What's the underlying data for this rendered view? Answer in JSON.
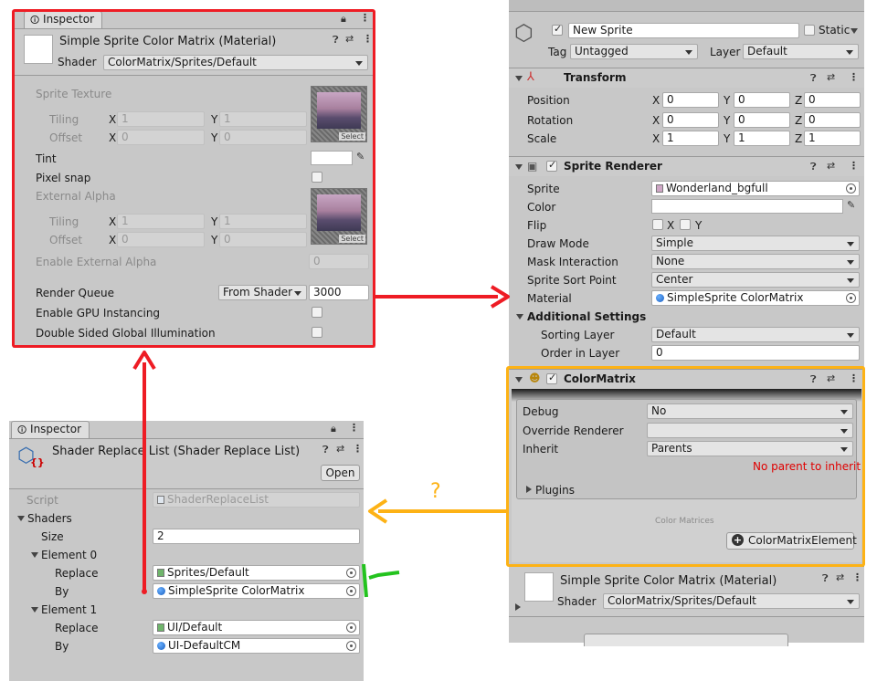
{
  "material_inspector": {
    "tab": "Inspector",
    "title": "Simple Sprite Color Matrix (Material)",
    "shader_label": "Shader",
    "shader_value": "ColorMatrix/Sprites/Default",
    "sprite_texture": "Sprite Texture",
    "tiling": "Tiling",
    "offset": "Offset",
    "x": "X",
    "y": "Y",
    "tiling_x": "1",
    "tiling_y": "1",
    "offset_x": "0",
    "offset_y": "0",
    "select": "Select",
    "tint": "Tint",
    "pixel_snap": "Pixel snap",
    "external_alpha": "External Alpha",
    "tiling2_x": "1",
    "tiling2_y": "1",
    "offset2_x": "0",
    "offset2_y": "0",
    "enable_external_alpha": "Enable External Alpha",
    "enable_external_alpha_value": "0",
    "render_queue": "Render Queue",
    "render_queue_mode": "From Shader",
    "render_queue_value": "3000",
    "gpu_instancing": "Enable GPU Instancing",
    "double_sided": "Double Sided Global Illumination"
  },
  "shader_replace": {
    "tab": "Inspector",
    "title": "Shader Replace List (Shader Replace List)",
    "open": "Open",
    "script_label": "Script",
    "script_value": "ShaderReplaceList",
    "shaders": "Shaders",
    "size_label": "Size",
    "size_value": "2",
    "element0": "Element 0",
    "replace": "Replace",
    "by": "By",
    "e0_replace": "Sprites/Default",
    "e0_by": "SimpleSprite ColorMatrix",
    "element1": "Element 1",
    "e1_replace": "UI/Default",
    "e1_by": "UI-DefaultCM"
  },
  "gameobject": {
    "name": "New Sprite",
    "static": "Static",
    "tag_label": "Tag",
    "tag_value": "Untagged",
    "layer_label": "Layer",
    "layer_value": "Default"
  },
  "transform": {
    "title": "Transform",
    "position": "Position",
    "rotation": "Rotation",
    "scale": "Scale",
    "x": "X",
    "y": "Y",
    "z": "Z",
    "pos": [
      "0",
      "0",
      "0"
    ],
    "rot": [
      "0",
      "0",
      "0"
    ],
    "scl": [
      "1",
      "1",
      "1"
    ]
  },
  "sprite_renderer": {
    "title": "Sprite Renderer",
    "sprite": "Sprite",
    "sprite_value": "Wonderland_bgfull",
    "color": "Color",
    "flip": "Flip",
    "flip_x": "X",
    "flip_y": "Y",
    "draw_mode": "Draw Mode",
    "draw_mode_value": "Simple",
    "mask_interaction": "Mask Interaction",
    "mask_interaction_value": "None",
    "sort_point": "Sprite Sort Point",
    "sort_point_value": "Center",
    "material": "Material",
    "material_value": "SimpleSprite ColorMatrix",
    "additional": "Additional Settings",
    "sorting_layer": "Sorting Layer",
    "sorting_layer_value": "Default",
    "order_in_layer": "Order in Layer",
    "order_in_layer_value": "0"
  },
  "color_matrix": {
    "title": "ColorMatrix",
    "debug": "Debug",
    "debug_value": "No",
    "override_renderer": "Override Renderer",
    "override_renderer_value": "",
    "inherit": "Inherit",
    "inherit_value": "Parents",
    "warning": "No parent to inherit",
    "plugins": "Plugins",
    "color_matrices": "Color Matrices",
    "add_element": "ColorMatrixElement"
  },
  "bottom_material": {
    "title": "Simple Sprite Color Matrix (Material)",
    "shader_label": "Shader",
    "shader_value": "ColorMatrix/Sprites/Default"
  },
  "annotation": {
    "question": "?"
  },
  "colors": {
    "red": "#ee1c24",
    "orange": "#fdb215",
    "green": "#23c31e",
    "warning": "#e00000"
  },
  "icons": [
    "info-icon",
    "lock-icon",
    "menu-icon",
    "help-icon",
    "settings-icon",
    "eyedropper-icon",
    "object-picker-icon",
    "cube-icon",
    "transform-icon",
    "sprite-renderer-icon",
    "script-icon",
    "plus-icon",
    "red-arrow",
    "orange-arrow",
    "green-check"
  ]
}
